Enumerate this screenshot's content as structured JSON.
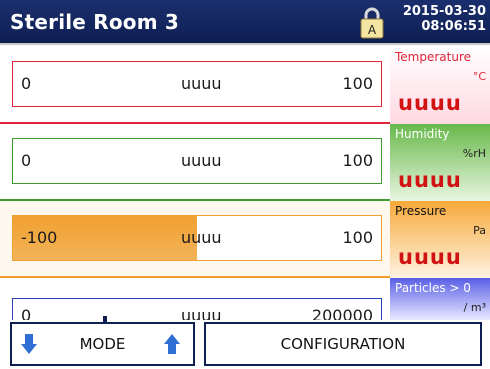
{
  "header": {
    "title": "Sterile Room 3",
    "date": "2015-03-30",
    "time": "08:06:51",
    "lock_letter": "A",
    "lock_icon": "padlock-icon"
  },
  "sensors": [
    {
      "name": "Temperature",
      "unit": "°C",
      "value": "uuuu",
      "min": "0",
      "mid": "uuuu",
      "max": "100",
      "fill_fraction": 0,
      "color": "#e0243a",
      "tile_gradient": [
        "#ffffff",
        "#ffd8e2"
      ]
    },
    {
      "name": "Humidity",
      "unit": "%rH",
      "value": "uuuu",
      "min": "0",
      "mid": "uuuu",
      "max": "100",
      "fill_fraction": 0,
      "color": "#3f9a2f",
      "tile_gradient": [
        "#67b84a",
        "#e9f6e2"
      ]
    },
    {
      "name": "Pressure",
      "unit": "Pa",
      "value": "uuuu",
      "min": "-100",
      "mid": "uuuu",
      "max": "100",
      "fill_fraction": 0.5,
      "color": "#f0a030",
      "tile_gradient": [
        "#f7a93a",
        "#fff3e2"
      ]
    },
    {
      "name": "Particles > 0",
      "unit": "/ m³",
      "value": "",
      "min": "0",
      "mid": "uuuu",
      "max": "200000",
      "fill_fraction": 0,
      "color": "#2b3fb8",
      "tile_gradient": [
        "#5a5fe6",
        "#e8e9ff"
      ]
    }
  ],
  "footer": {
    "mode_label": "MODE",
    "config_label": "CONFIGURATION",
    "down_icon": "arrow-down-icon",
    "up_icon": "arrow-up-icon",
    "accent": "#0e1f52",
    "arrow_color": "#2f6fd3"
  }
}
